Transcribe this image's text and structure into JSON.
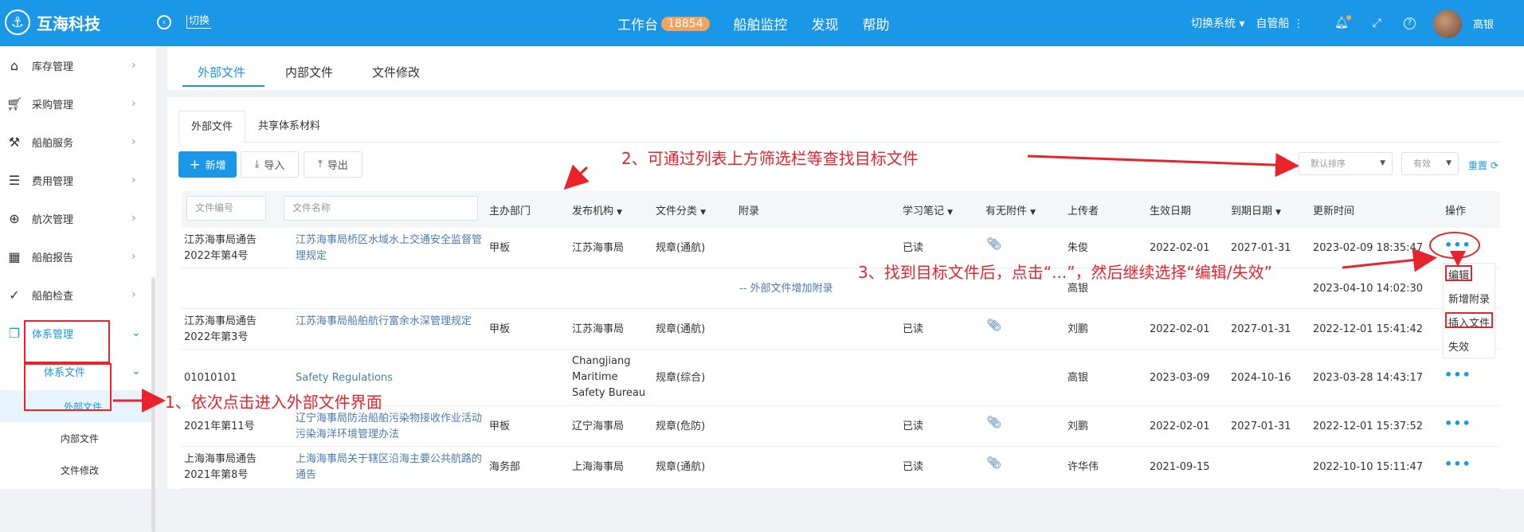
{
  "topbar": {
    "brand": "互海科技",
    "switch_label": "切换",
    "nav": [
      "工作台",
      "船舶监控",
      "发现",
      "帮助"
    ],
    "workbench_badge": "18854",
    "switch_system": "切换系统",
    "own_ship": "自管船",
    "user": "高银"
  },
  "sidebar": {
    "items": [
      {
        "label": "库存管理",
        "icon": "warehouse-icon"
      },
      {
        "label": "采购管理",
        "icon": "cart-icon"
      },
      {
        "label": "船舶服务",
        "icon": "roller-icon"
      },
      {
        "label": "费用管理",
        "icon": "coins-icon"
      },
      {
        "label": "航次管理",
        "icon": "globe-icon"
      },
      {
        "label": "船舶报告",
        "icon": "calendar-icon"
      },
      {
        "label": "船舶检查",
        "icon": "check-circle-icon"
      },
      {
        "label": "体系管理",
        "icon": "docs-icon"
      }
    ],
    "sub_group": "体系文件",
    "sub_items": [
      "外部文件",
      "内部文件",
      "文件修改"
    ]
  },
  "tabs_top": [
    "外部文件",
    "内部文件",
    "文件修改"
  ],
  "subtabs": [
    "外部文件",
    "共享体系材料"
  ],
  "toolbar": {
    "add": "新增",
    "import": "导入",
    "export": "导出"
  },
  "filters": {
    "sort": "默认排序",
    "status": "有效",
    "reset": "重置"
  },
  "table": {
    "filter_no": "文件编号",
    "filter_name": "文件名称",
    "headers": [
      "主办部门",
      "发布机构",
      "文件分类",
      "附录",
      "学习笔记",
      "有无附件",
      "上传者",
      "生效日期",
      "到期日期",
      "更新时间",
      "操作"
    ],
    "rows": [
      {
        "no": "江苏海事局通告2022年第4号",
        "name": "江苏海事局桥区水域水上交通安全监督管理规定",
        "dept": "甲板",
        "org": "江苏海事局",
        "cat": "规章(通航)",
        "note": "已读",
        "uploader": "朱俊",
        "eff": "2022-02-01",
        "exp": "2027-01-31",
        "upd": "2023-02-09 18:35:47"
      },
      {
        "appendix": "-- 外部文件增加附录",
        "uploader": "高银",
        "upd": "2023-04-10 14:02:30"
      },
      {
        "no": "江苏海事局通告2022年第3号",
        "name": "江苏海事局船舶航行富余水深管理规定",
        "dept": "甲板",
        "org": "江苏海事局",
        "cat": "规章(通航)",
        "note": "已读",
        "uploader": "刘鹏",
        "eff": "2022-02-01",
        "exp": "2027-01-31",
        "upd": "2022-12-01 15:41:42"
      },
      {
        "no": "01010101",
        "name": "Safety Regulations",
        "dept": "",
        "org": "Changjiang Maritime Safety Bureau",
        "cat": "规章(综合)",
        "note": "",
        "uploader": "高银",
        "eff": "2023-03-09",
        "exp": "2024-10-16",
        "upd": "2023-03-28 14:43:17"
      },
      {
        "no": "2021年第11号",
        "name": "辽宁海事局防治船舶污染物接收作业活动污染海洋环境管理办法",
        "dept": "甲板",
        "org": "辽宁海事局",
        "cat": "规章(危防)",
        "note": "已读",
        "uploader": "刘鹏",
        "eff": "2022-02-01",
        "exp": "2027-01-31",
        "upd": "2022-12-01 15:37:52"
      },
      {
        "no": "上海海事局通告2021年第8号",
        "name": "上海海事局关于辖区沿海主要公共航路的通告",
        "dept": "海务部",
        "org": "上海海事局",
        "cat": "规章(通航)",
        "note": "已读",
        "uploader": "许华伟",
        "eff": "2021-09-15",
        "exp": "",
        "upd": "2022-10-10 15:11:47"
      }
    ]
  },
  "action_menu": [
    "编辑",
    "新增附录",
    "插入文件",
    "失效"
  ],
  "annotations": {
    "step1": "1、依次点击进入外部文件界面",
    "step2": "2、可通过列表上方筛选栏等查找目标文件",
    "step3": "3、找到目标文件后，点击“...”，然后继续选择“编辑/失效”"
  },
  "colors": {
    "primary": "#1a97e6",
    "annotation": "#e8232a"
  }
}
